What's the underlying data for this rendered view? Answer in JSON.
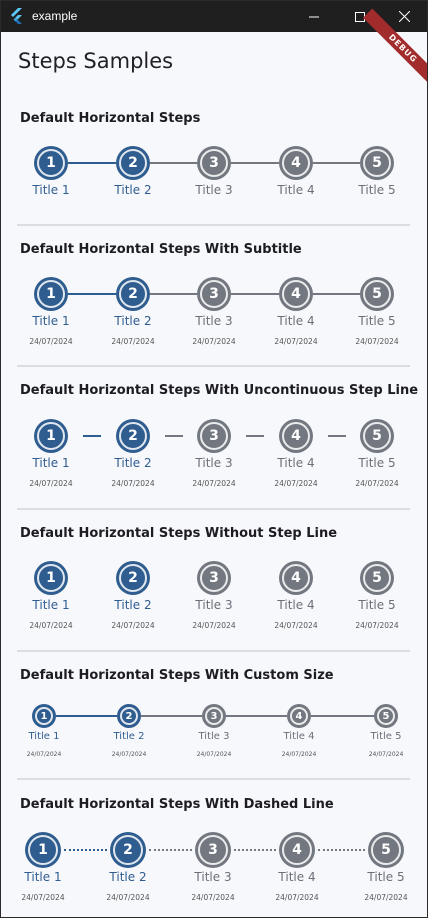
{
  "window": {
    "title": "example",
    "controls": [
      "minimize-icon",
      "maximize-icon",
      "close-icon"
    ]
  },
  "debug_banner": "DEBUG",
  "page_title": "Steps Samples",
  "colors": {
    "active": "#2f5d8f",
    "inactive": "#737780",
    "active_text": "#2f5d8f",
    "inactive_text": "#6c6f78"
  },
  "sections": [
    {
      "title": "Default Horizontal Steps",
      "line_style": "solid",
      "steps": [
        {
          "number": "1",
          "title": "Title 1",
          "active": true
        },
        {
          "number": "2",
          "title": "Title 2",
          "active": true
        },
        {
          "number": "3",
          "title": "Title 3",
          "active": false
        },
        {
          "number": "4",
          "title": "Title 4",
          "active": false
        },
        {
          "number": "5",
          "title": "Title 5",
          "active": false
        }
      ]
    },
    {
      "title": "Default Horizontal Steps With Subtitle",
      "line_style": "solid",
      "steps": [
        {
          "number": "1",
          "title": "Title 1",
          "subtitle": "24/07/2024",
          "active": true
        },
        {
          "number": "2",
          "title": "Title 2",
          "subtitle": "24/07/2024",
          "active": true
        },
        {
          "number": "3",
          "title": "Title 3",
          "subtitle": "24/07/2024",
          "active": false
        },
        {
          "number": "4",
          "title": "Title 4",
          "subtitle": "24/07/2024",
          "active": false
        },
        {
          "number": "5",
          "title": "Title 5",
          "subtitle": "24/07/2024",
          "active": false
        }
      ]
    },
    {
      "title": "Default Horizontal Steps With Uncontinuous Step Line",
      "line_style": "uncontinuous",
      "steps": [
        {
          "number": "1",
          "title": "Title 1",
          "subtitle": "24/07/2024",
          "active": true
        },
        {
          "number": "2",
          "title": "Title 2",
          "subtitle": "24/07/2024",
          "active": true
        },
        {
          "number": "3",
          "title": "Title 3",
          "subtitle": "24/07/2024",
          "active": false
        },
        {
          "number": "4",
          "title": "Title 4",
          "subtitle": "24/07/2024",
          "active": false
        },
        {
          "number": "5",
          "title": "Title 5",
          "subtitle": "24/07/2024",
          "active": false
        }
      ]
    },
    {
      "title": "Default Horizontal Steps Without Step Line",
      "line_style": "none",
      "steps": [
        {
          "number": "1",
          "title": "Title 1",
          "subtitle": "24/07/2024",
          "active": true
        },
        {
          "number": "2",
          "title": "Title 2",
          "subtitle": "24/07/2024",
          "active": true
        },
        {
          "number": "3",
          "title": "Title 3",
          "subtitle": "24/07/2024",
          "active": false
        },
        {
          "number": "4",
          "title": "Title 4",
          "subtitle": "24/07/2024",
          "active": false
        },
        {
          "number": "5",
          "title": "Title 5",
          "subtitle": "24/07/2024",
          "active": false
        }
      ]
    },
    {
      "title": "Default Horizontal Steps With Custom Size",
      "line_style": "solid",
      "size": "small",
      "steps": [
        {
          "number": "1",
          "title": "Title 1",
          "subtitle": "24/07/2024",
          "active": true
        },
        {
          "number": "2",
          "title": "Title 2",
          "subtitle": "24/07/2024",
          "active": true
        },
        {
          "number": "3",
          "title": "Title 3",
          "subtitle": "24/07/2024",
          "active": false
        },
        {
          "number": "4",
          "title": "Title 4",
          "subtitle": "24/07/2024",
          "active": false
        },
        {
          "number": "5",
          "title": "Title 5",
          "subtitle": "24/07/2024",
          "active": false
        }
      ]
    },
    {
      "title": "Default Horizontal Steps With Dashed Line",
      "line_style": "dashed",
      "size": "large",
      "steps": [
        {
          "number": "1",
          "title": "Title 1",
          "subtitle": "24/07/2024",
          "active": true
        },
        {
          "number": "2",
          "title": "Title 2",
          "subtitle": "24/07/2024",
          "active": true
        },
        {
          "number": "3",
          "title": "Title 3",
          "subtitle": "24/07/2024",
          "active": false
        },
        {
          "number": "4",
          "title": "Title 4",
          "subtitle": "24/07/2024",
          "active": false
        },
        {
          "number": "5",
          "title": "Title 5",
          "subtitle": "24/07/2024",
          "active": false
        }
      ]
    }
  ]
}
